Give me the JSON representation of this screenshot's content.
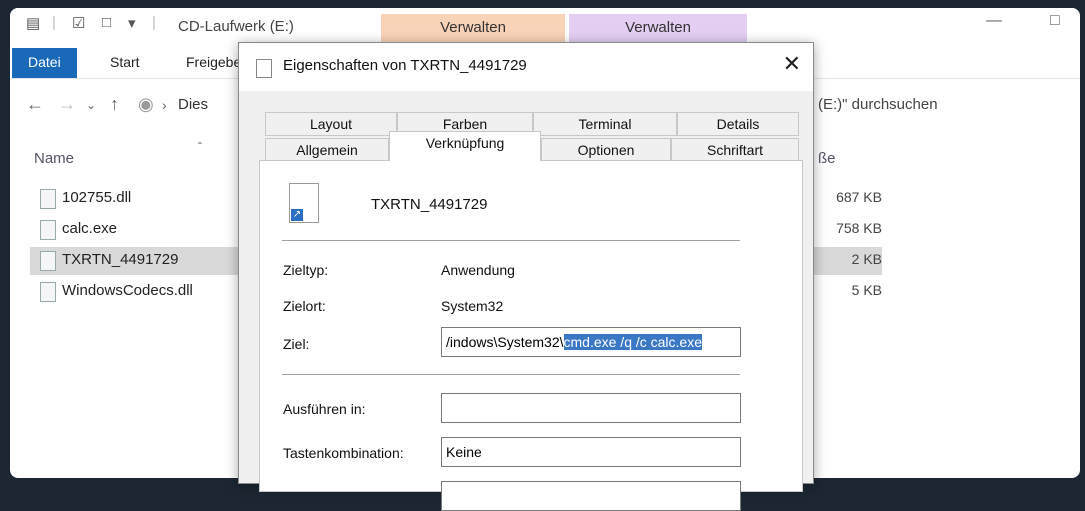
{
  "explorer": {
    "title": "CD-Laufwerk (E:)",
    "context_tabs": [
      "Verwalten",
      "Verwalten"
    ],
    "ribbon_tabs": [
      "Datei",
      "Start",
      "Freigebe"
    ],
    "address_path": "Dies",
    "search_placeholder": "(E:)\" durchsuchen",
    "columns": {
      "name": "Name",
      "size": "ße"
    },
    "files": [
      {
        "name": "102755.dll",
        "size": "687 KB"
      },
      {
        "name": "calc.exe",
        "size": "758 KB"
      },
      {
        "name": "TXRTN_4491729",
        "size": "2 KB"
      },
      {
        "name": "WindowsCodecs.dll",
        "size": "5 KB"
      }
    ]
  },
  "dialog": {
    "title": "Eigenschaften von TXRTN_4491729",
    "tabs_row1": [
      "Layout",
      "Farben",
      "Terminal",
      "Details"
    ],
    "tabs_row2": [
      "Allgemein",
      "Verknüpfung",
      "Optionen",
      "Schriftart"
    ],
    "active_tab": "Verknüpfung",
    "shortcut_name": "TXRTN_4491729",
    "fields": {
      "zieltyp_label": "Zieltyp:",
      "zieltyp_value": "Anwendung",
      "zielort_label": "Zielort:",
      "zielort_value": "System32",
      "ziel_label": "Ziel:",
      "ziel_value_plain": "/indows\\System32\\",
      "ziel_value_selected": "cmd.exe /q /c calc.exe",
      "ausfuehren_label": "Ausführen in:",
      "ausfuehren_value": "",
      "tasten_label": "Tastenkombination:",
      "tasten_value": "Keine"
    }
  }
}
